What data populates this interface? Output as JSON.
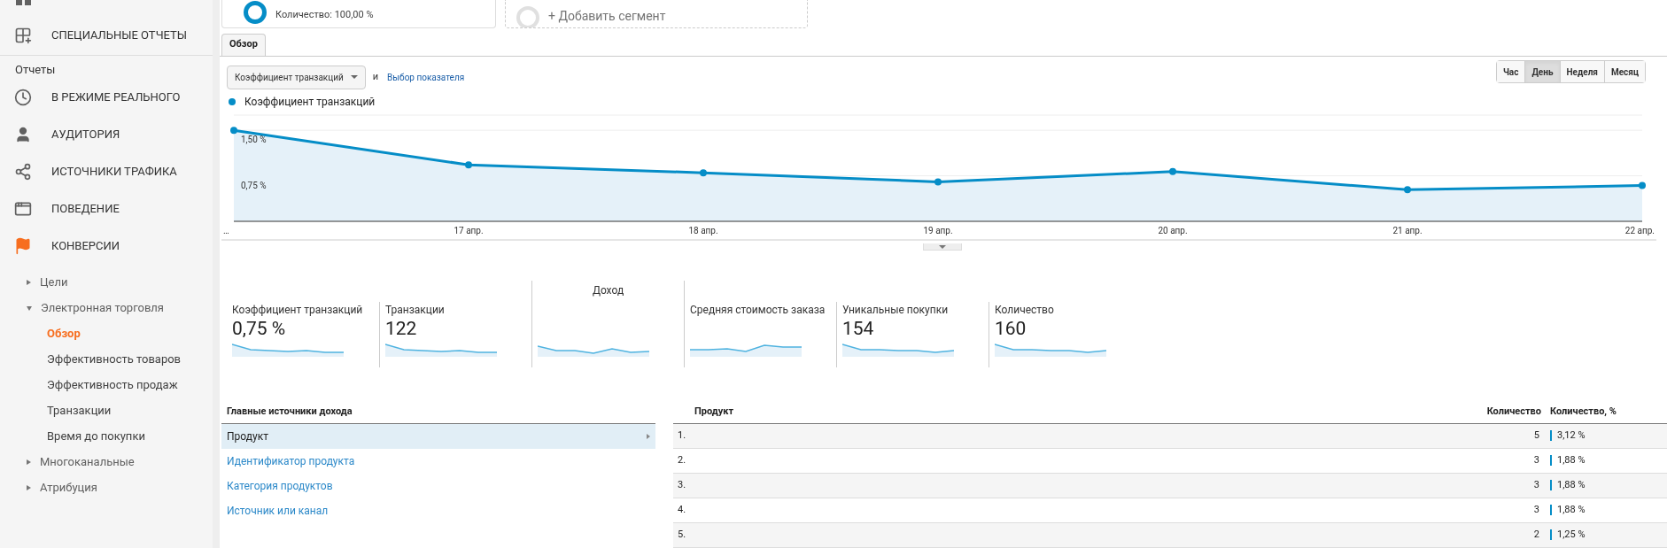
{
  "segments": [
    {
      "kind": "segment",
      "text": "Количество: 100,00 %"
    },
    {
      "kind": "add",
      "text": "+ Добавить сегмент"
    }
  ],
  "sidebar": {
    "top_items": [
      {
        "label": "СПЕЦИАЛЬНЫЕ ОТЧЕТЫ"
      }
    ],
    "section_title": "Отчеты",
    "items": [
      {
        "label": "В РЕЖИМЕ РЕАЛЬНОГО"
      },
      {
        "label": "АУДИТОРИЯ"
      },
      {
        "label": "ИСТОЧНИКИ ТРАФИКА"
      },
      {
        "label": "ПОВЕДЕНИЕ"
      },
      {
        "label": "КОНВЕРСИИ"
      }
    ],
    "tree": [
      {
        "label": "Цели",
        "expanded": false
      },
      {
        "label": "Электронная торговля",
        "expanded": true,
        "children": [
          {
            "label": "Обзор",
            "selected": true
          },
          {
            "label": "Эффективность товаров",
            "selected": false
          },
          {
            "label": "Эффективность продаж",
            "selected": false
          },
          {
            "label": "Транзакции",
            "selected": false
          },
          {
            "label": "Время до покупки",
            "selected": false
          }
        ]
      },
      {
        "label": "Многоканальные",
        "expanded": false
      },
      {
        "label": "Атрибуция",
        "expanded": false
      }
    ]
  },
  "tabs": [
    {
      "label": "Обзор",
      "selected": true
    }
  ],
  "metric_dropdown": {
    "value": "Коэффициент транзакций"
  },
  "and_text": "и",
  "metric_picker_link": "Выбор показателя",
  "granularity": [
    {
      "label": "Час",
      "selected": false
    },
    {
      "label": "День",
      "selected": true
    },
    {
      "label": "Неделя",
      "selected": false
    },
    {
      "label": "Месяц",
      "selected": false
    }
  ],
  "chart": {
    "chart_data": {
      "type": "area",
      "categories": [
        "…",
        "17 апр.",
        "18 апр.",
        "19 апр.",
        "20 апр.",
        "21 апр.",
        "22 апр."
      ],
      "series": [
        {
          "name": "Коэффициент транзакций",
          "color": "#058dc7",
          "values": [
            1.5,
            0.93,
            0.8,
            0.65,
            0.82,
            0.52,
            0.59
          ]
        }
      ],
      "ylim": [
        0,
        1.75
      ],
      "yticks": [
        {
          "value": 0.75,
          "label": "0,75 %"
        },
        {
          "value": 1.5,
          "label": "1,50 %"
        }
      ]
    }
  },
  "metrics": [
    {
      "kind": "value",
      "label": "Коэффициент транзакций",
      "value": "0,75 %"
    },
    {
      "kind": "value",
      "label": "Транзакции",
      "value": "122"
    },
    {
      "kind": "header",
      "label": "Доход"
    },
    {
      "kind": "value",
      "label": "Средняя стоимость заказа"
    },
    {
      "kind": "value",
      "label": "Уникальные покупки",
      "value": "154"
    },
    {
      "kind": "value",
      "label": "Количество",
      "value": "160"
    }
  ],
  "dimensions": {
    "title": "Главные источники дохода",
    "items": [
      {
        "label": "Продукт",
        "selected": true
      },
      {
        "label": "Идентификатор продукта",
        "selected": false
      },
      {
        "label": "Категория продуктов",
        "selected": false
      },
      {
        "label": "Источник или канал",
        "selected": false
      }
    ]
  },
  "table": {
    "columns": [
      "Продукт",
      "Количество",
      "Количество, %"
    ],
    "rows": [
      {
        "rank": "1.",
        "quantity": "5",
        "percent": "3,12 %"
      },
      {
        "rank": "2.",
        "quantity": "3",
        "percent": "1,88 %"
      },
      {
        "rank": "3.",
        "quantity": "3",
        "percent": "1,88 %"
      },
      {
        "rank": "4.",
        "quantity": "3",
        "percent": "1,88 %"
      },
      {
        "rank": "5.",
        "quantity": "2",
        "percent": "1,25 %"
      }
    ]
  }
}
